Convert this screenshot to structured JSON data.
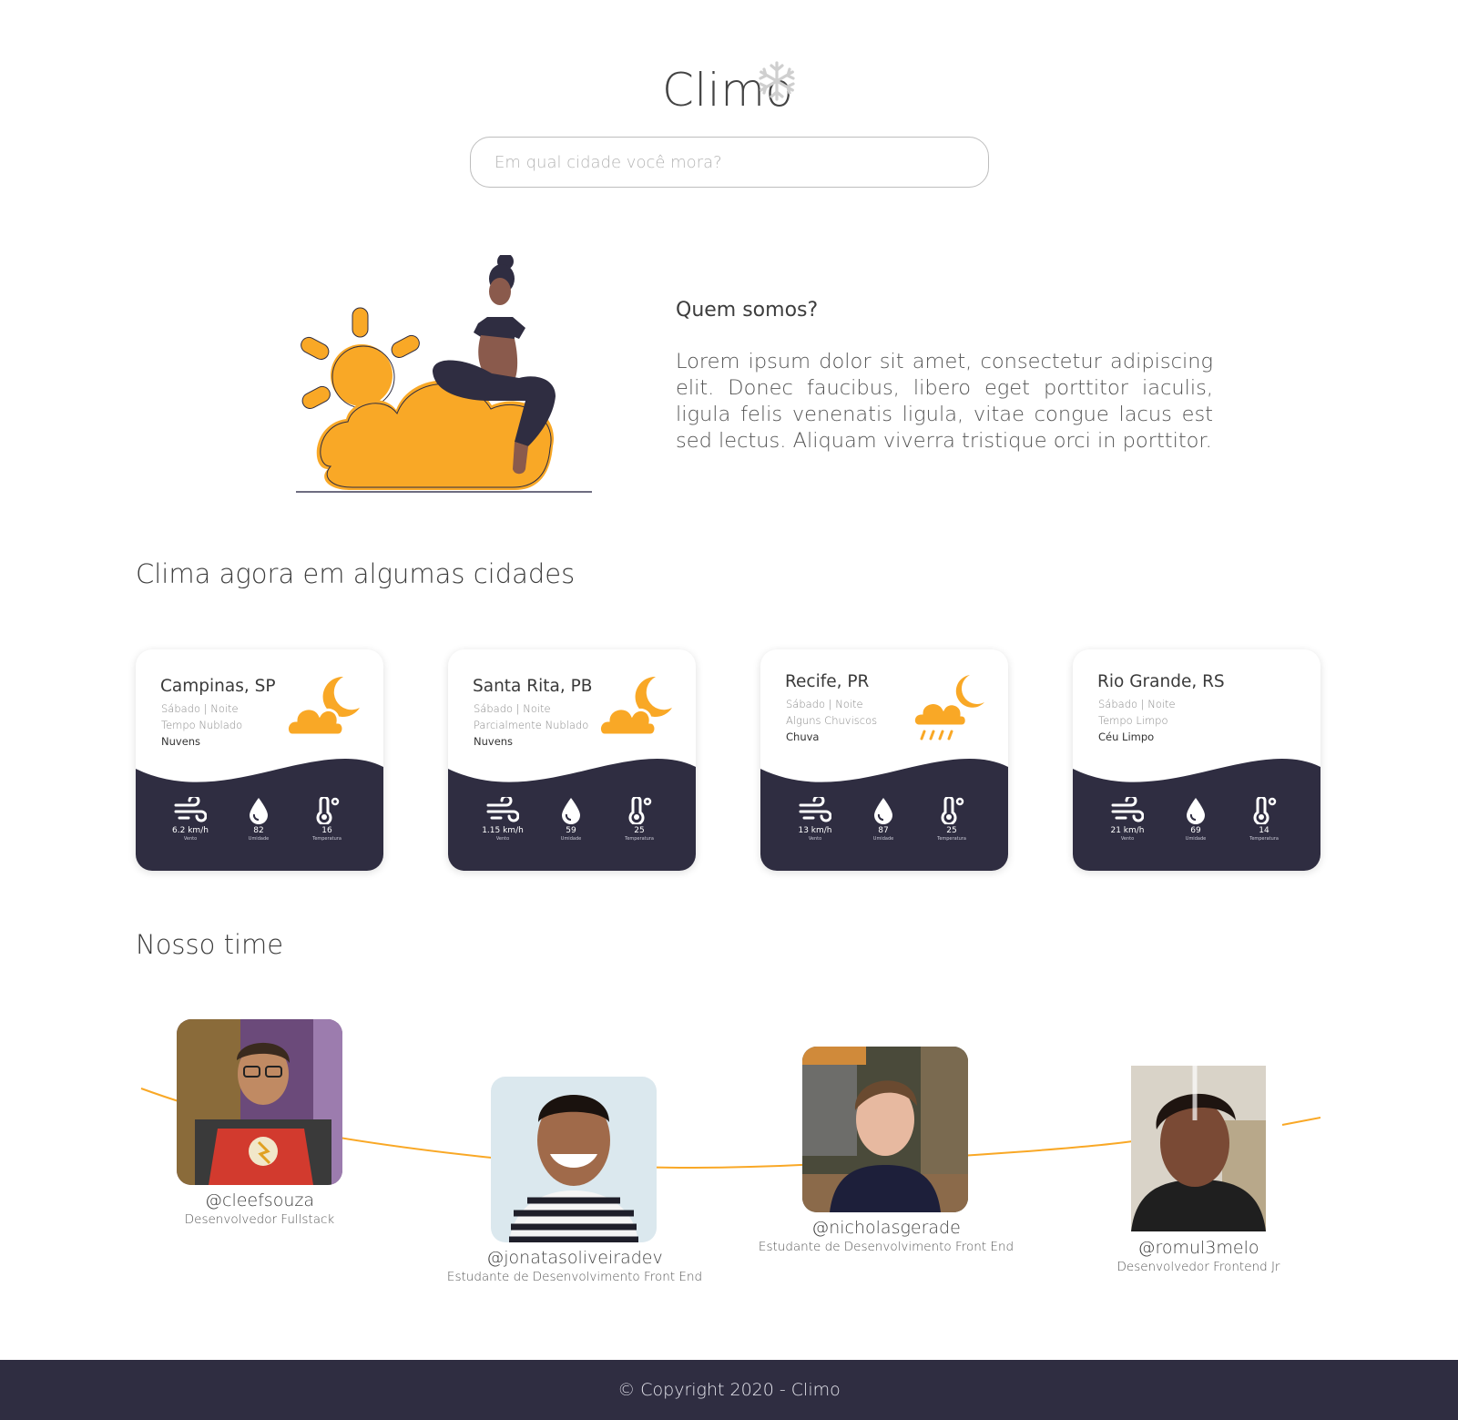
{
  "header": {
    "logo_text": "Climo",
    "logo_icon": "snowflake-icon",
    "search_placeholder": "Em qual cidade você mora?"
  },
  "about": {
    "title": "Quem somos?",
    "text": "Lorem ipsum dolor sit amet, consectetur adipiscing elit. Donec faucibus, libero eget porttitor iaculis, ligula felis venenatis ligula, vitae congue lacus est sed lectus. Aliquam viverra tristique orci in porttitor."
  },
  "weather_section": {
    "title": "Clima agora em algumas cidades",
    "cards": [
      {
        "city": "Campinas, SP",
        "day": "Sábado | Noite",
        "desc": "Tempo Nublado",
        "condition": "Nuvens",
        "icon": "cloud-moon-icon",
        "wind": "6.2 km/h",
        "wind_label": "Vento",
        "humidity": "82",
        "humidity_label": "Umidade",
        "temperature": "16",
        "temperature_label": "Temperatura"
      },
      {
        "city": "Santa Rita, PB",
        "day": "Sábado | Noite",
        "desc": "Parcialmente Nublado",
        "condition": "Nuvens",
        "icon": "cloud-moon-icon",
        "wind": "1.15 km/h",
        "wind_label": "Vento",
        "humidity": "59",
        "humidity_label": "Umidade",
        "temperature": "25",
        "temperature_label": "Temperatura"
      },
      {
        "city": "Recife, PR",
        "day": "Sábado | Noite",
        "desc": "Alguns Chuviscos",
        "condition": "Chuva",
        "icon": "rain-cloud-moon-icon",
        "wind": "13 km/h",
        "wind_label": "Vento",
        "humidity": "87",
        "humidity_label": "Umidade",
        "temperature": "25",
        "temperature_label": "Temperatura"
      },
      {
        "city": "Rio Grande, RS",
        "day": "Sábado | Noite",
        "desc": "Tempo Limpo",
        "condition": "Céu Limpo",
        "icon": "moon-icon",
        "wind": "21 km/h",
        "wind_label": "Vento",
        "humidity": "69",
        "humidity_label": "Umidade",
        "temperature": "14",
        "temperature_label": "Temperatura"
      }
    ]
  },
  "team_section": {
    "title": "Nosso time",
    "members": [
      {
        "handle": "@cleefsouza",
        "role": "Desenvolvedor Fullstack"
      },
      {
        "handle": "@jonatasoliveiradev",
        "role": "Estudante de Desenvolvimento Front End"
      },
      {
        "handle": "@nicholasgerade",
        "role": "Estudante de Desenvolvimento Front End"
      },
      {
        "handle": "@romul3melo",
        "role": "Desenvolvedor Frontend Jr"
      }
    ]
  },
  "footer": {
    "copyright": "© Copyright 2020 - Climo"
  },
  "colors": {
    "accent": "#f9a826",
    "dark": "#2f2d41",
    "text": "#3a3a3a"
  }
}
